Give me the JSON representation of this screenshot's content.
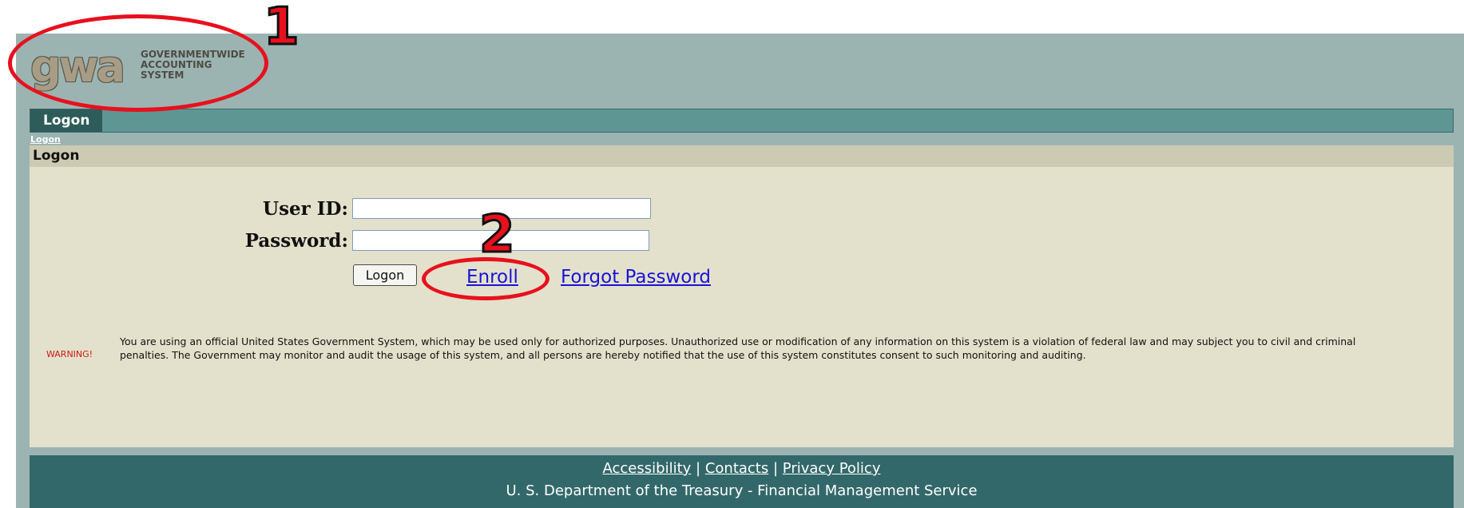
{
  "logo": {
    "mark": "gwa",
    "lines": [
      "GOVERNMENTWIDE",
      "ACCOUNTING",
      "SYSTEM"
    ]
  },
  "tabs": [
    {
      "label": "Logon"
    }
  ],
  "breadcrumb": "Logon",
  "panel": {
    "title": "Logon",
    "user_id_label": "User ID:",
    "password_label": "Password:",
    "user_id_value": "",
    "password_value": "",
    "logon_button": "Logon",
    "enroll_link": "Enroll",
    "forgot_link": "Forgot Password",
    "warning_tag": "WARNING!",
    "warning_text": "You are using an official United States Government System, which may be used only for authorized purposes. Unauthorized use or modification of any information on this system is a violation of federal law and may subject you to civil and criminal penalties. The Government may monitor and audit the usage of this system, and all persons are hereby notified that the use of this system constitutes consent to such monitoring and  auditing."
  },
  "footer": {
    "links": [
      "Accessibility",
      "Contacts",
      "Privacy Policy"
    ],
    "separator": "|",
    "org": "U. S. Department of the Treasury - Financial Management Service"
  },
  "annotations": {
    "color": "#e8101d",
    "labels": [
      "1",
      "2"
    ]
  }
}
